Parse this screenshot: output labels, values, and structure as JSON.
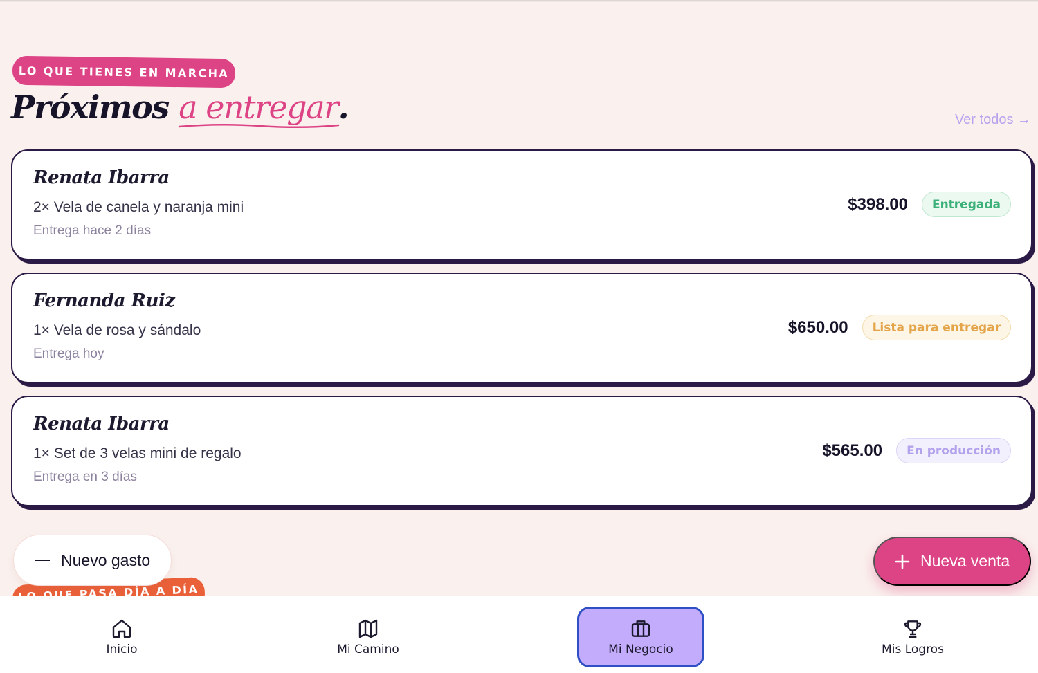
{
  "section": {
    "eyebrow": "LO QUE TIENES EN MARCHA",
    "title_main": "Próximos ",
    "title_accent": "a entregar",
    "title_end": ".",
    "view_all": "Ver todos →"
  },
  "orders": [
    {
      "name": "Renata Ibarra",
      "item": "2× Vela de canela y naranja mini",
      "when": "Entrega hace 2 días",
      "amount": "$398.00",
      "status": "Entregada",
      "status_color": "#3bb078"
    },
    {
      "name": "Fernanda Ruiz",
      "item": "1× Vela de rosa y sándalo",
      "when": "Entrega hoy",
      "amount": "$650.00",
      "status": "Lista para entregar",
      "status_color": "#e3a44a"
    },
    {
      "name": "Renata Ibarra",
      "item": "1× Set de 3 velas mini de regalo",
      "when": "Entrega en 3 días",
      "amount": "$565.00",
      "status": "En producción",
      "status_color": "#b3a2ec"
    }
  ],
  "actions": {
    "new_expense": "Nuevo gasto",
    "new_sale": "Nueva venta"
  },
  "next_section": {
    "eyebrow": "LO QUE PASA DÍA A DÍA"
  },
  "nav": {
    "items": [
      {
        "label": "Inicio",
        "icon": "home-icon"
      },
      {
        "label": "Mi Camino",
        "icon": "map-icon"
      },
      {
        "label": "Mi Negocio",
        "icon": "briefcase-icon",
        "active": true
      },
      {
        "label": "Mis Logros",
        "icon": "trophy-icon"
      }
    ]
  },
  "colors": {
    "background": "#faf1ee",
    "accent_pink": "#dd4485",
    "accent_orange": "#ea6139",
    "nav_active": "#c3acfb",
    "ink": "#17142a"
  }
}
